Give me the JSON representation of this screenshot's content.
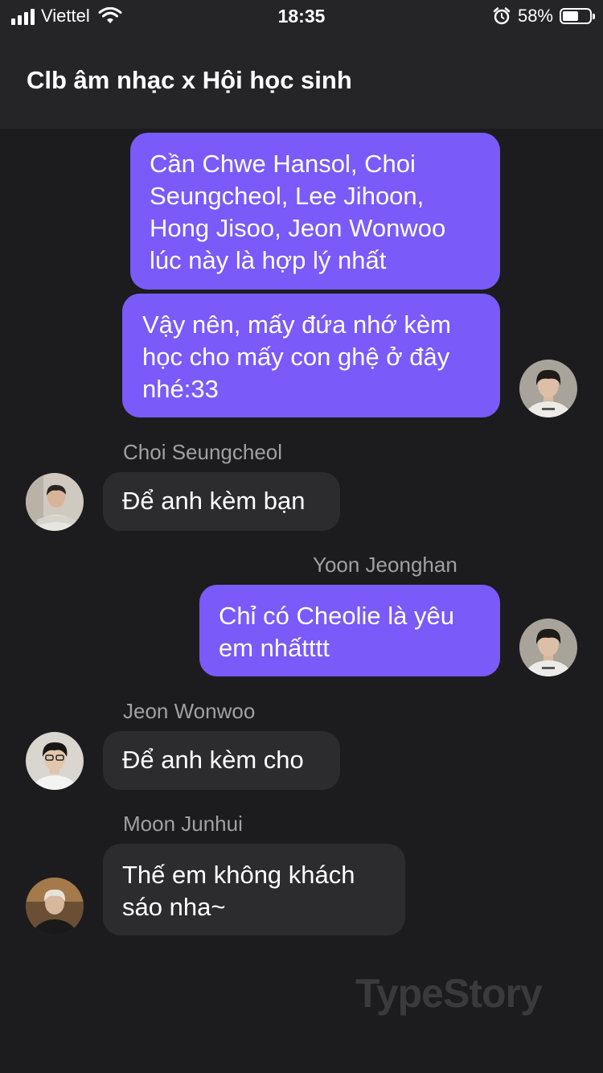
{
  "status_bar": {
    "carrier": "Viettel",
    "time": "18:35",
    "battery_percent": "58%",
    "battery_level": 0.58,
    "icons": [
      "signal-icon",
      "wifi-icon",
      "alarm-icon",
      "battery-icon"
    ]
  },
  "header": {
    "title": "Clb âm nhạc x Hội học sinh"
  },
  "messages": [
    {
      "direction": "out",
      "text": "Cần Chwe Hansol, Choi Seungcheol, Lee Jihoon, Hong Jisoo, Jeon Wonwoo lúc này là hợp lý nhất"
    },
    {
      "direction": "out",
      "text": "Vậy nên, mấy đứa nhớ kèm học cho mấy con ghệ ở đây nhé:33"
    },
    {
      "direction": "in",
      "sender": "Choi Seungcheol",
      "text": "Để anh kèm bạn"
    },
    {
      "direction": "out",
      "sender": "Yoon Jeonghan",
      "text": "Chỉ có Cheolie là yêu em nhấtttt"
    },
    {
      "direction": "in",
      "sender": "Jeon Wonwoo",
      "text": "Để anh kèm cho"
    },
    {
      "direction": "in",
      "sender": "Moon Junhui",
      "text": "Thế em không khách sáo nha~"
    }
  ],
  "watermark": "TypeStory",
  "colors": {
    "background": "#1c1c1e",
    "header": "#252527",
    "outgoing_bubble": "#7a5af8",
    "incoming_bubble": "#2c2c2e",
    "sender_name": "#a0a0a5"
  }
}
